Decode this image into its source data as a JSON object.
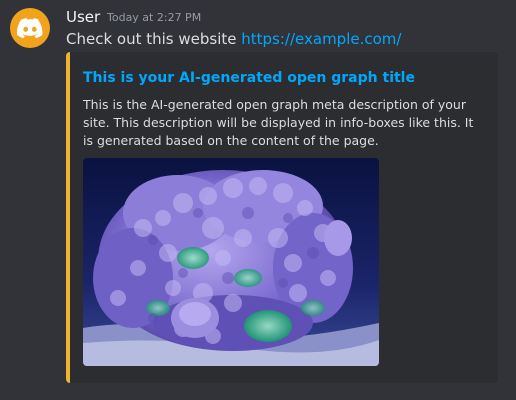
{
  "message": {
    "author": "User",
    "timestamp": "Today at 2:27 PM",
    "text_prefix": "Check out this website ",
    "link": "https://example.com/"
  },
  "avatar": {
    "icon": "discord-logo-icon",
    "color": "#f0a31b"
  },
  "embed": {
    "accent_color": "#f0b232",
    "title": "This is your AI-generated open graph title",
    "description": "This is the AI-generated open graph meta description of your site. This description will be displayed in info-boxes like this. It is generated based on the content of the page.",
    "image_subject": "coral-photo"
  },
  "colors": {
    "background": "#313338",
    "embed_background": "#2b2d31",
    "link": "#00a8fc"
  }
}
